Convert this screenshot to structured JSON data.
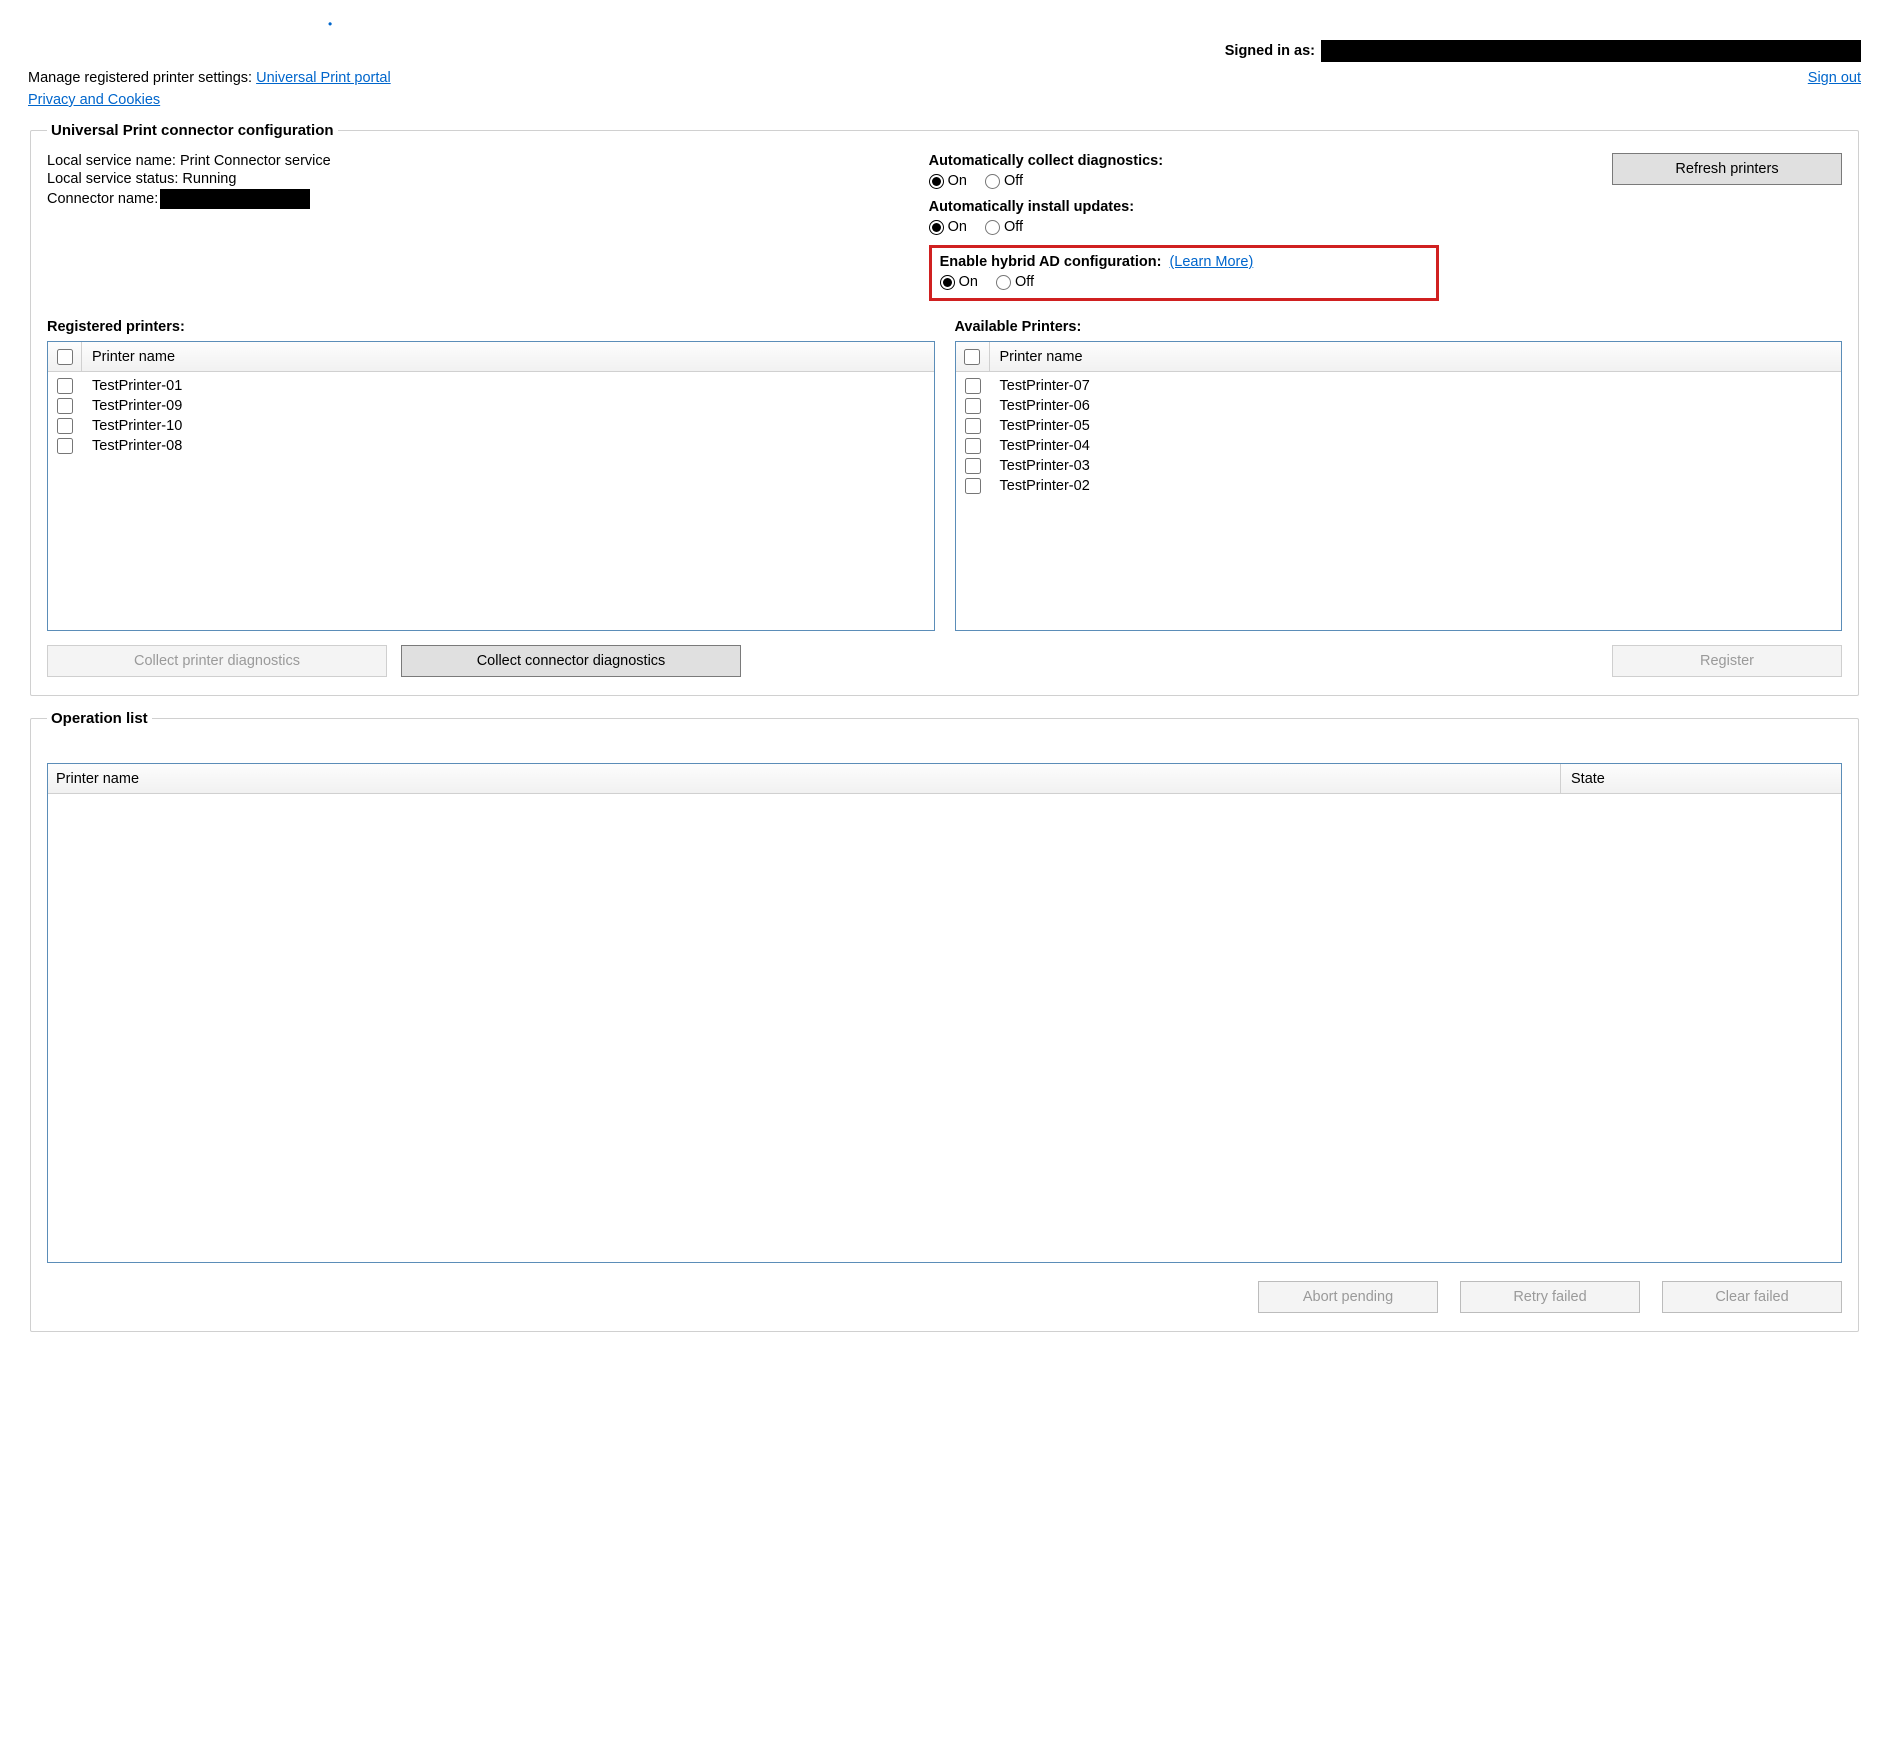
{
  "header": {
    "signed_in_label": "Signed in as:",
    "manage_prefix": "Manage registered printer settings: ",
    "portal_link": "Universal Print portal",
    "privacy_link": "Privacy and Cookies",
    "sign_out": "Sign out"
  },
  "config": {
    "legend": "Universal Print connector configuration",
    "local_service_name_label": "Local service name: ",
    "local_service_name_value": "Print Connector service",
    "local_service_status_label": "Local service status: ",
    "local_service_status_value": "Running",
    "connector_name_label": "Connector name: ",
    "refresh_button": "Refresh printers",
    "settings": {
      "diag": {
        "label": "Automatically collect diagnostics:",
        "on": "On",
        "off": "Off",
        "selected": "on"
      },
      "updates": {
        "label": "Automatically install updates:",
        "on": "On",
        "off": "Off",
        "selected": "on"
      },
      "hybrid": {
        "label": "Enable hybrid AD configuration:",
        "learn_more": "(Learn More)",
        "on": "On",
        "off": "Off",
        "selected": "on"
      }
    },
    "registered": {
      "heading": "Registered printers:",
      "column": "Printer name",
      "items": [
        "TestPrinter-01",
        "TestPrinter-09",
        "TestPrinter-10",
        "TestPrinter-08"
      ],
      "collect_printer_diag": "Collect printer diagnostics",
      "collect_connector_diag": "Collect connector diagnostics"
    },
    "available": {
      "heading": "Available Printers:",
      "column": "Printer name",
      "items": [
        "TestPrinter-07",
        "TestPrinter-06",
        "TestPrinter-05",
        "TestPrinter-04",
        "TestPrinter-03",
        "TestPrinter-02"
      ],
      "register_button": "Register"
    }
  },
  "operations": {
    "legend": "Operation list",
    "col_printer": "Printer name",
    "col_state": "State",
    "abort": "Abort pending",
    "retry": "Retry failed",
    "clear": "Clear failed"
  }
}
